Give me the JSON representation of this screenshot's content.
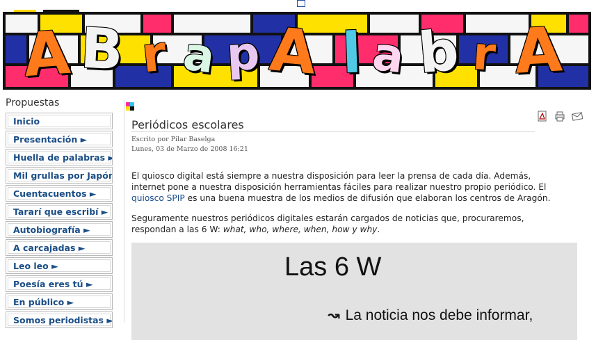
{
  "banner": {
    "letters": [
      "A",
      "B",
      "r",
      "a",
      "p",
      "A",
      "l",
      "a",
      "b",
      "r",
      "A"
    ],
    "colors": [
      "#ff7a1a",
      "#f3f3f3",
      "#ff7a1a",
      "#d9f7e4",
      "#e8c8f0",
      "#ff7a1a",
      "#4fc9e6",
      "#ffd6f0",
      "#f3f3f3",
      "#ff7a1a",
      "#ff7a1a"
    ]
  },
  "sidebar": {
    "heading": "Propuestas",
    "items": [
      {
        "label": "Inicio"
      },
      {
        "label": "Presentación ►"
      },
      {
        "label": "Huella de palabras ►"
      },
      {
        "label": "Mil grullas por Japón"
      },
      {
        "label": "Cuentacuentos ►"
      },
      {
        "label": "Tararí que escribí ►"
      },
      {
        "label": "Autobiografía ►"
      },
      {
        "label": "A carcajadas ►"
      },
      {
        "label": "Leo leo ►"
      },
      {
        "label": "Poesía eres tú ►"
      },
      {
        "label": "En público ►"
      },
      {
        "label": "Somos periodistas ►"
      }
    ]
  },
  "article": {
    "title": "Periódicos escolares",
    "byline": "Escrito por Pilar Baselga",
    "date": "Lunes, 03 de Marzo de 2008 16:21",
    "p1_a": "El quiosco digital está siempre a nuestra disposición para leer la prensa de cada día. Además, internet pone a nuestra disposición herramientas fáciles para realizar nuestro propio periódico. El ",
    "p1_link": "quiosco SPIP",
    "p1_b": " es una buena muestra de los medios de difusión que elaboran los centros de Aragón.",
    "p2_a": "Seguramente nuestros periódicos digitales estarán cargados de noticias que, procuraremos, respondan a las 6 W: ",
    "p2_em": "what, who, where, when, how y why",
    "p2_b": ".",
    "tools": [
      "pdf-icon",
      "print-icon",
      "email-icon"
    ]
  },
  "slide": {
    "title": "Las 6 W",
    "bullet": "La noticia nos debe informar,"
  }
}
